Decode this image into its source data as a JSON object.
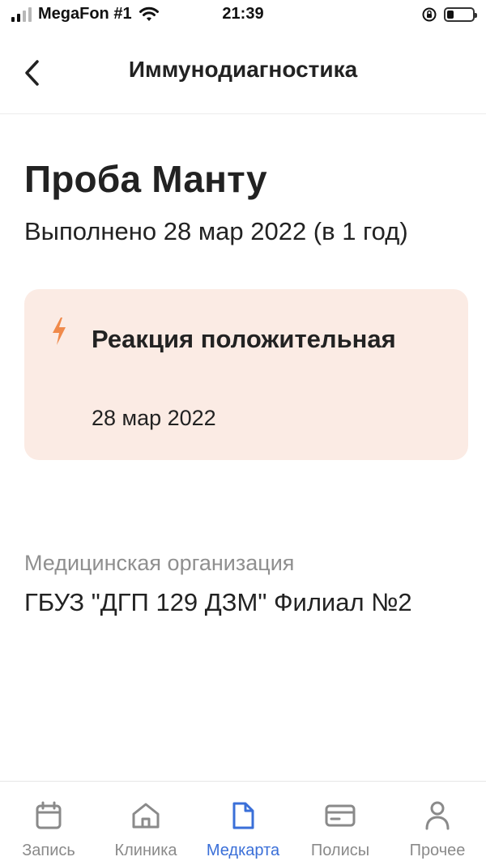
{
  "status_bar": {
    "carrier": "MegaFon #1",
    "time": "21:39"
  },
  "header": {
    "title": "Иммунодиагностика"
  },
  "main": {
    "title": "Проба Манту",
    "performed": "Выполнено 28 мар 2022 (в 1 год)",
    "result": {
      "title": "Реакция положительная",
      "date": "28 мар 2022",
      "icon": "lightning-icon",
      "background": "#fbebe4",
      "icon_color": "#f08a4b"
    },
    "organization": {
      "label": "Медицинская организация",
      "value": "ГБУЗ \"ДГП 129 ДЗМ\" Филиал №2"
    }
  },
  "tab_bar": {
    "active_color": "#3a6fd8",
    "inactive_color": "#8a8a8a",
    "tabs": [
      {
        "label": "Запись",
        "icon": "calendar-icon",
        "active": false
      },
      {
        "label": "Клиника",
        "icon": "clinic-icon",
        "active": false
      },
      {
        "label": "Медкарта",
        "icon": "document-icon",
        "active": true
      },
      {
        "label": "Полисы",
        "icon": "card-icon",
        "active": false
      },
      {
        "label": "Прочее",
        "icon": "person-icon",
        "active": false
      }
    ]
  }
}
